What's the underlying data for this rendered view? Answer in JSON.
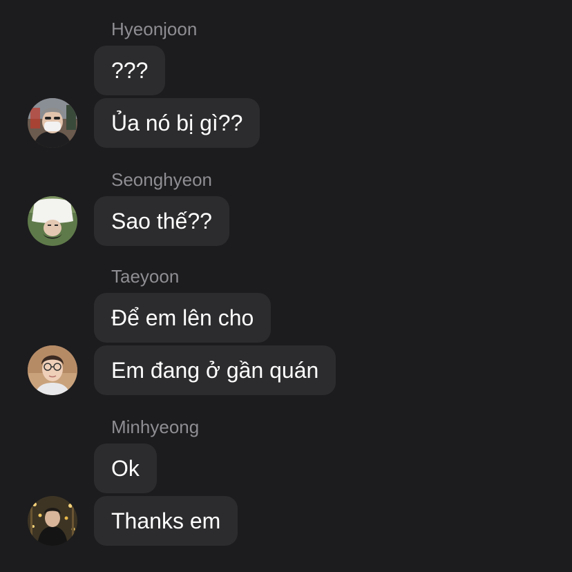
{
  "chat": {
    "groups": [
      {
        "sender": "Hyeonjoon",
        "avatar_icon": "avatar-hyeonjoon-photo",
        "messages": [
          "???",
          "Ủa nó bị gì??"
        ]
      },
      {
        "sender": "Seonghyeon",
        "avatar_icon": "avatar-seonghyeon-photo",
        "messages": [
          "Sao thế??"
        ]
      },
      {
        "sender": "Taeyoon",
        "avatar_icon": "avatar-taeyoon-photo",
        "messages": [
          "Để em lên cho",
          "Em đang ở gần quán"
        ]
      },
      {
        "sender": "Minhyeong",
        "avatar_icon": "avatar-minhyeong-photo",
        "messages": [
          "Ok",
          "Thanks em"
        ]
      }
    ]
  },
  "colors": {
    "background": "#1c1c1e",
    "bubble": "#2c2c2e",
    "sender_name": "#8e8e93",
    "message_text": "#ffffff"
  }
}
